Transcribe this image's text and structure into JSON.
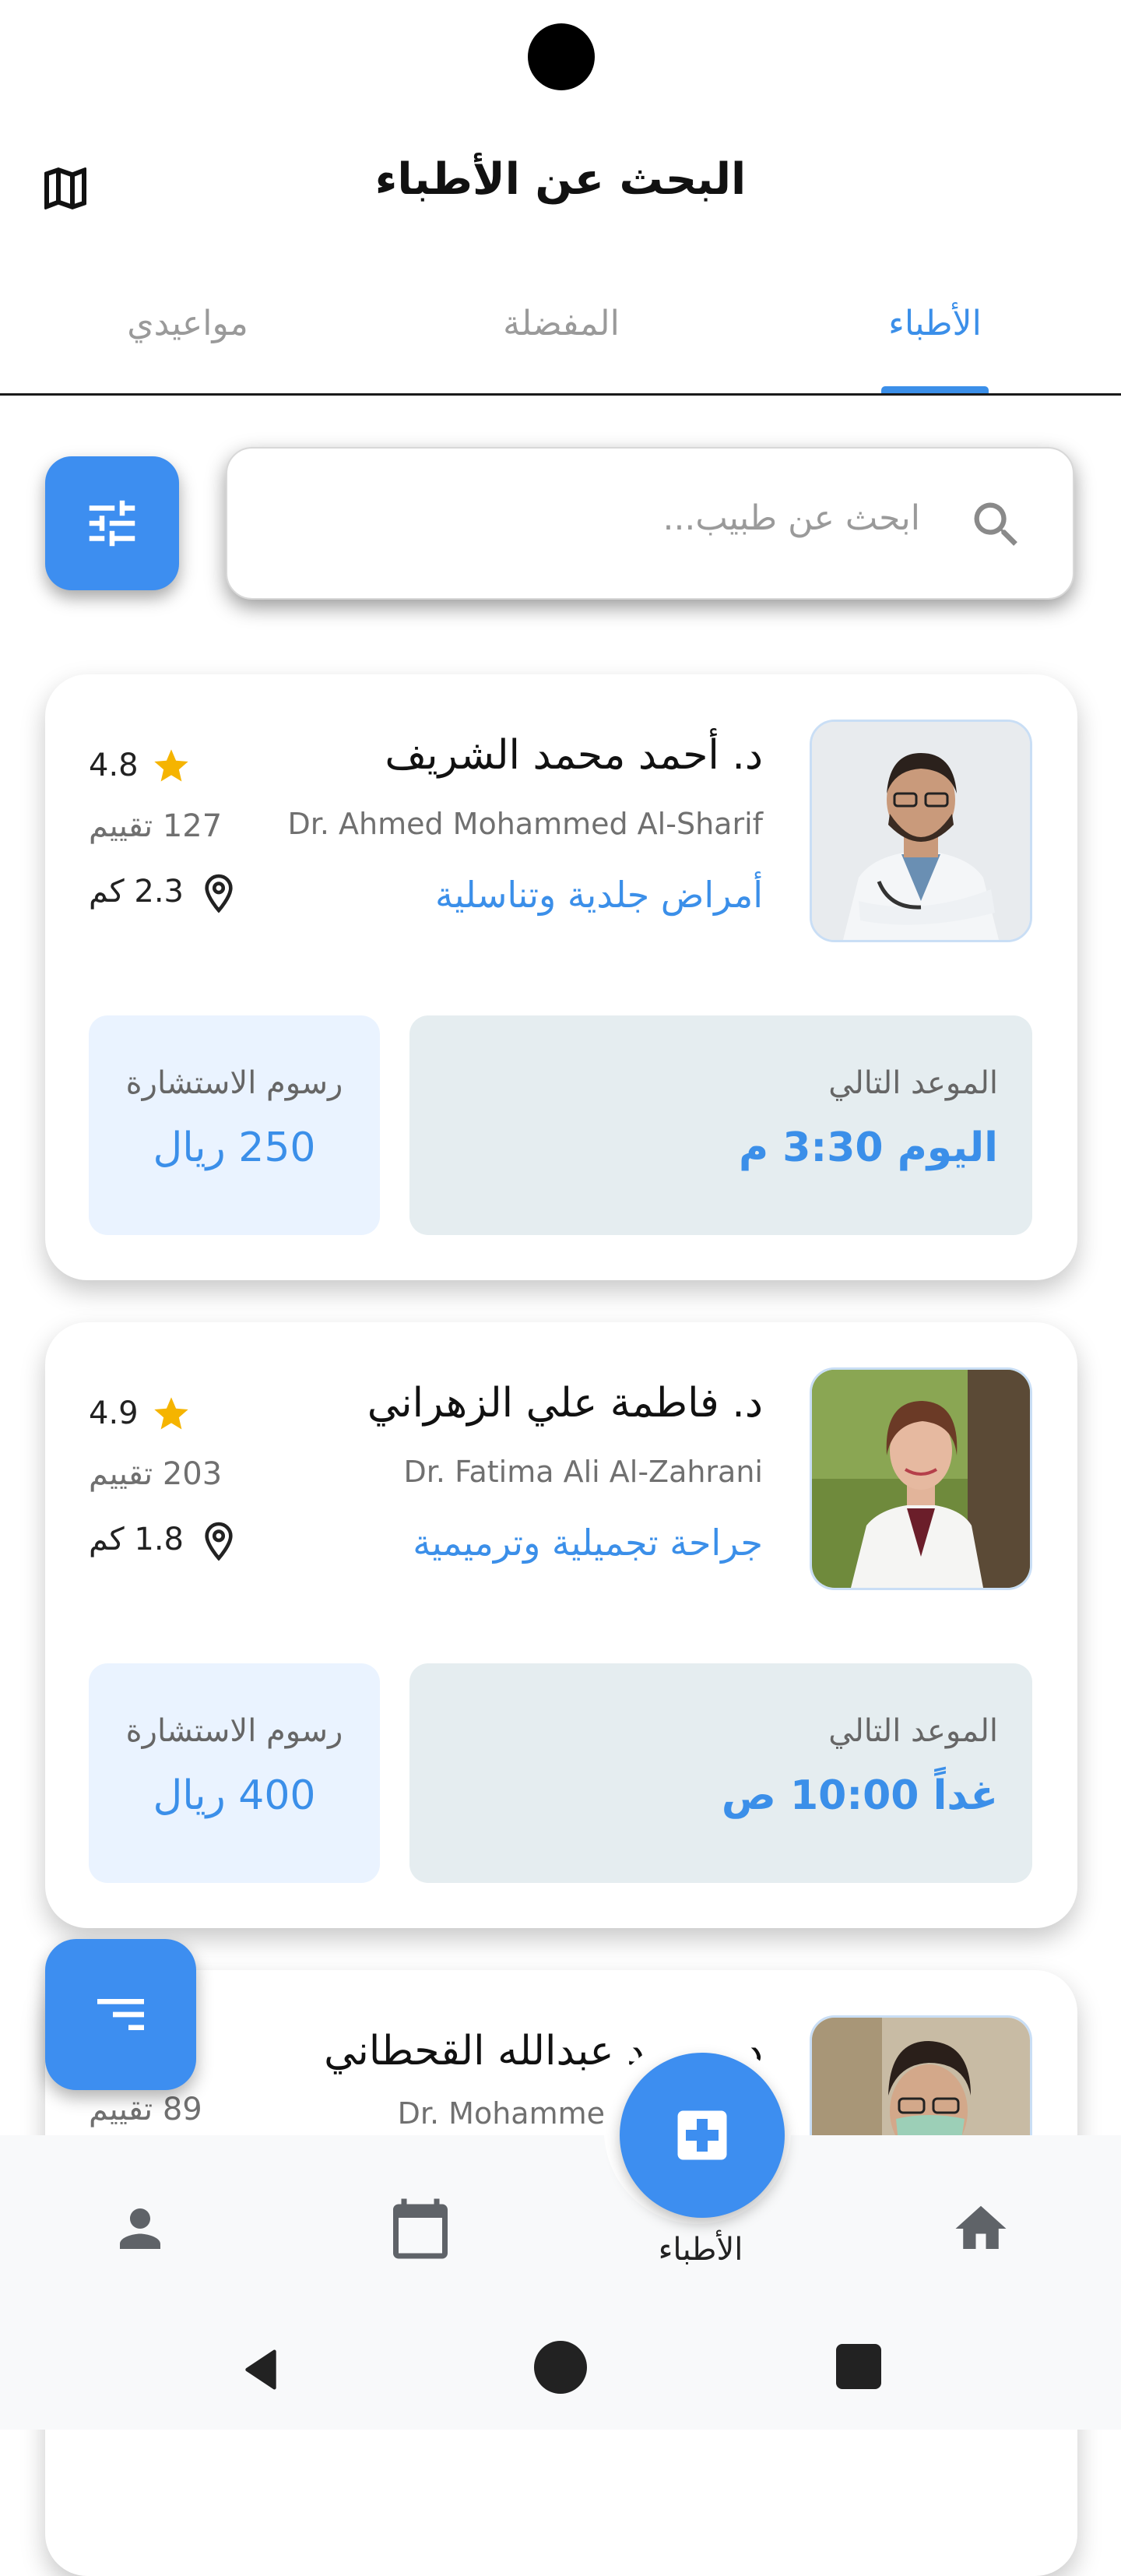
{
  "header": {
    "title": "البحث عن الأطباء",
    "map_icon": "map-icon"
  },
  "tabs": [
    {
      "label": "الأطباء",
      "active": true
    },
    {
      "label": "المفضلة",
      "active": false
    },
    {
      "label": "مواعيدي",
      "active": false
    }
  ],
  "search": {
    "placeholder": "ابحث عن طبيب...",
    "filter_icon": "sliders-icon"
  },
  "doctors": [
    {
      "name_ar": "د. أحمد محمد الشريف",
      "name_en": "Dr. Ahmed Mohammed Al-Sharif",
      "specialty": "أمراض جلدية وتناسلية",
      "rating": "4.8",
      "reviews": "127 تقييم",
      "distance": "2.3 كم",
      "next_label": "الموعد التالي",
      "next_value": "اليوم 3:30 م",
      "fee_label": "رسوم الاستشارة",
      "fee_value": "250 ريال"
    },
    {
      "name_ar": "د. فاطمة علي الزهراني",
      "name_en": "Dr. Fatima Ali Al-Zahrani",
      "specialty": "جراحة تجميلية وترميمية",
      "rating": "4.9",
      "reviews": "203 تقييم",
      "distance": "1.8 كم",
      "next_label": "الموعد التالي",
      "next_value": "غداً 10:00 ص",
      "fee_label": "رسوم الاستشارة",
      "fee_value": "400 ريال"
    },
    {
      "name_ar": "د. محمد عبدالله القحطاني",
      "name_en": "Dr. Mohammed Abdullah",
      "reviews": "89 تقييم"
    }
  ],
  "bottom_nav": {
    "items": [
      {
        "icon": "home-icon"
      },
      {
        "icon": "doctors-icon",
        "label": "الأطباء",
        "active": true
      },
      {
        "icon": "calendar-icon"
      },
      {
        "icon": "profile-icon"
      }
    ]
  },
  "colors": {
    "accent": "#3b8fe9",
    "fab": "#3d8ef0",
    "star": "#f5b400"
  }
}
